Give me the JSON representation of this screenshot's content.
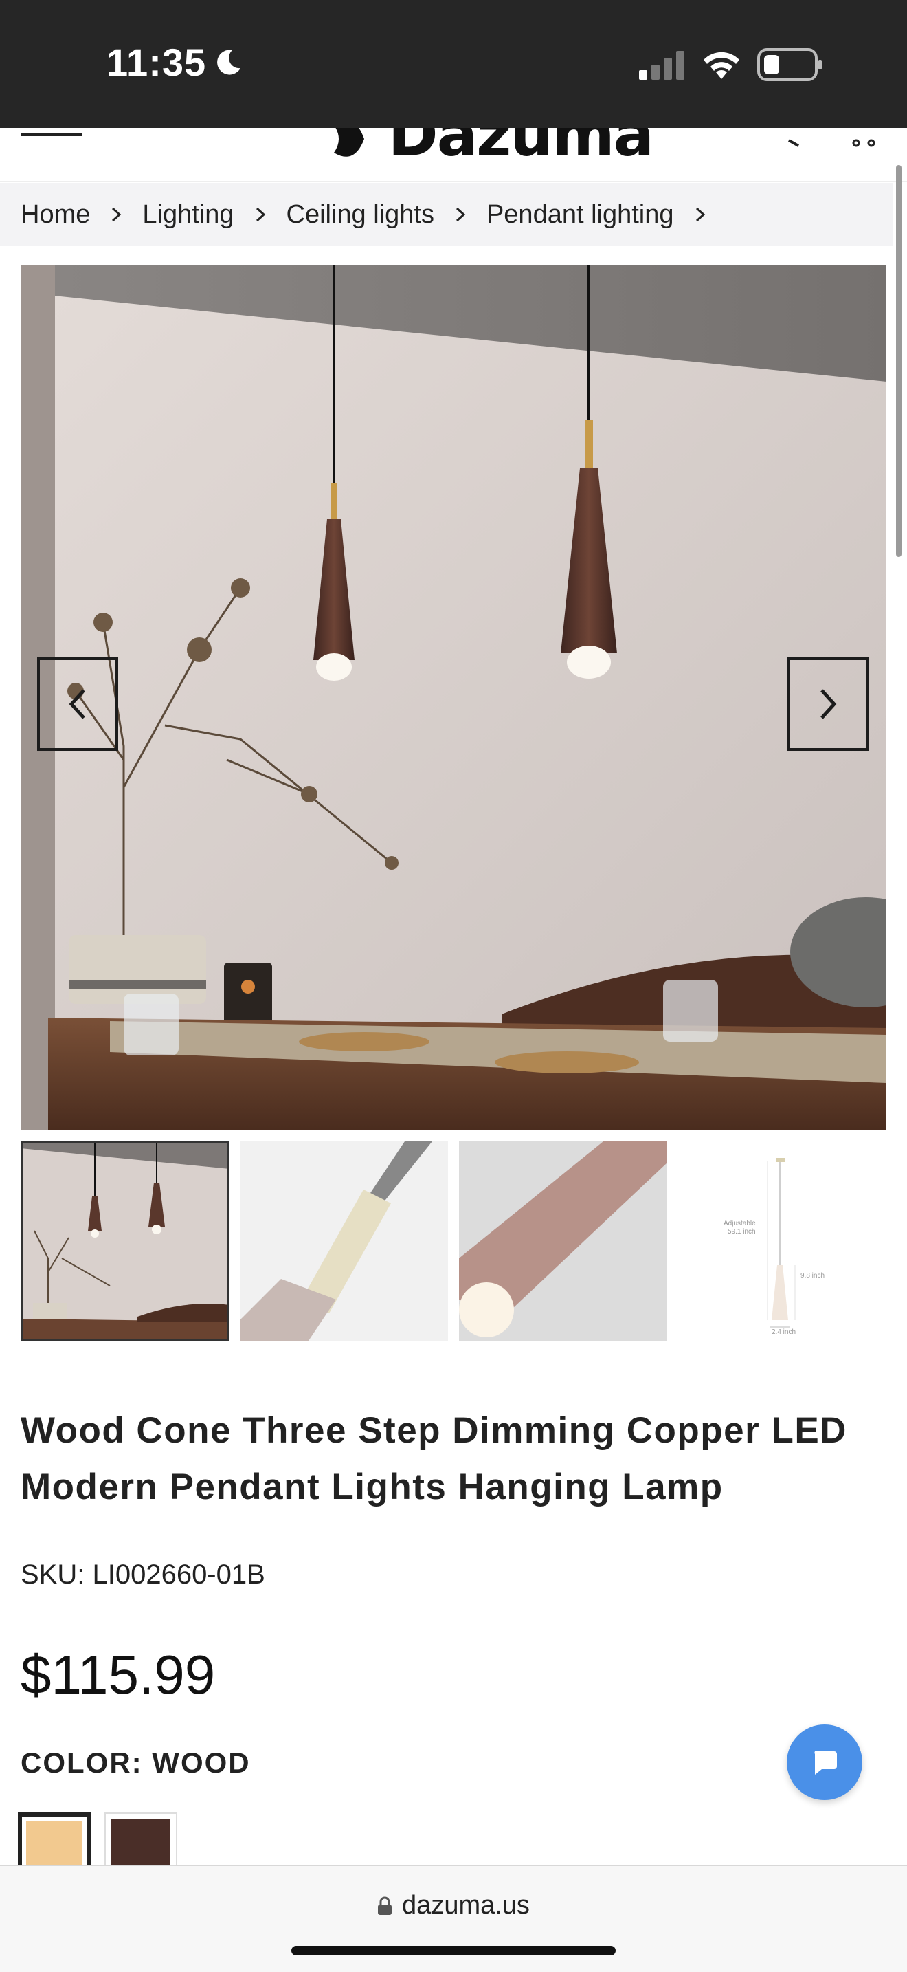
{
  "status_bar": {
    "time": "11:35",
    "icons": [
      "moon-icon",
      "signal-icon",
      "wifi-icon",
      "battery-icon"
    ]
  },
  "header": {
    "logo": "Dazuma",
    "icons": [
      "menu-icon",
      "search-icon",
      "cart-icon"
    ]
  },
  "breadcrumb": [
    "Home",
    "Lighting",
    "Ceiling lights",
    "Pendant lighting"
  ],
  "gallery": {
    "thumbnail_count": 4,
    "thumb4_labels": {
      "adjustable": "Adjustable",
      "length": "59.1 inch",
      "height": "9.8 inch",
      "width": "2.4 inch"
    }
  },
  "product": {
    "title": "Wood Cone Three Step Dimming Copper LED Modern Pendant Lights Hanging Lamp",
    "sku": "SKU: LI002660-01B",
    "price": "$115.99",
    "color_label": "COLOR: WOOD",
    "swatches": [
      {
        "name": "light wood",
        "color": "#f2c98f",
        "selected": true
      },
      {
        "name": "dark wood",
        "color": "#4a2e28",
        "selected": false
      }
    ]
  },
  "colors": {
    "chat_button": "#4a90e8",
    "status_bar": "#262626",
    "breadcrumb_bg": "#f3f3f5"
  },
  "url_bar": {
    "domain": "dazuma.us"
  }
}
